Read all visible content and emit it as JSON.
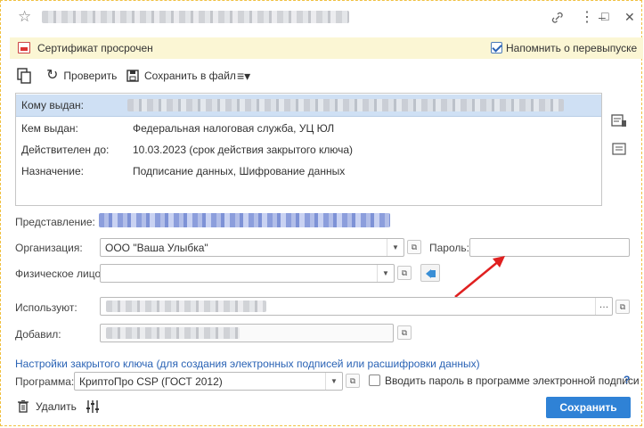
{
  "window": {
    "title_hidden": "",
    "controls": {
      "link_icon": "link-icon",
      "more_icon": "more-icon",
      "minimize": "–",
      "maximize": "□",
      "close": "✕"
    }
  },
  "banner": {
    "text": "Сертификат просрочен",
    "remind_label": "Напомнить о перевыпуске",
    "remind_checked": true
  },
  "toolbar": {
    "check_label": "Проверить",
    "save_file_label": "Сохранить в файл",
    "menu_icon": "≡▾"
  },
  "info": {
    "rows": [
      {
        "key": "Кому выдан:",
        "value": ""
      },
      {
        "key": "Кем выдан:",
        "value": "Федеральная налоговая служба, УЦ ЮЛ"
      },
      {
        "key": "Действителен до:",
        "value": "10.03.2023 (срок действия закрытого ключа)"
      },
      {
        "key": "Назначение:",
        "value": "Подписание данных, Шифрование данных"
      }
    ]
  },
  "form": {
    "presentation_label": "Представление:",
    "org_label": "Организация:",
    "org_value": "ООО \"Ваша Улыбка\"",
    "password_label": "Пароль:",
    "password_value": "",
    "person_label": "Физическое лицо:",
    "person_value": "",
    "used_by_label": "Используют:",
    "added_label": "Добавил:",
    "key_settings_link": "Настройки закрытого ключа (для создания электронных подписей или расшифровки данных)",
    "program_label": "Программа:",
    "program_value": "КриптоПро CSP (ГОСТ 2012)",
    "enter_pwd_label": "Вводить пароль в программе электронной подписи",
    "enter_pwd_checked": false,
    "help_mark": "?"
  },
  "footer": {
    "delete_label": "Удалить",
    "save_label": "Сохранить"
  },
  "colors": {
    "accent": "#2f82d6",
    "banner_bg": "#fbf6d4",
    "selected_row": "#cfe0f4",
    "arrow": "#e02020"
  }
}
